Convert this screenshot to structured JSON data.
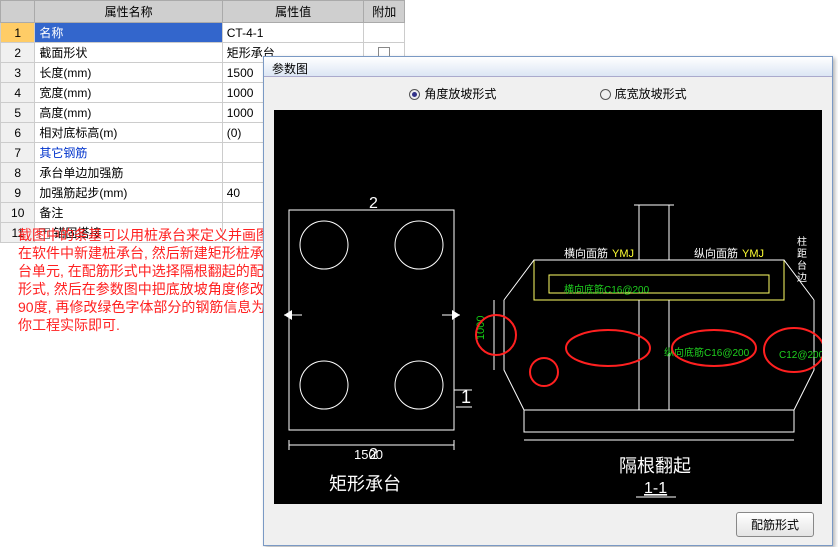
{
  "headers": {
    "name": "属性名称",
    "value": "属性值",
    "aux": "附加"
  },
  "rows": [
    {
      "n": "1",
      "name": "名称",
      "val": "CT-4-1",
      "sel": true
    },
    {
      "n": "2",
      "name": "截面形状",
      "val": "矩形承台",
      "chk": true
    },
    {
      "n": "3",
      "name": "长度(mm)",
      "val": "1500"
    },
    {
      "n": "4",
      "name": "宽度(mm)",
      "val": "1000"
    },
    {
      "n": "5",
      "name": "高度(mm)",
      "val": "1000"
    },
    {
      "n": "6",
      "name": "相对底标高(m)",
      "val": "(0)"
    },
    {
      "n": "7",
      "name": "其它钢筋",
      "val": "",
      "blue": true
    },
    {
      "n": "8",
      "name": "承台单边加强筋",
      "val": ""
    },
    {
      "n": "9",
      "name": "加强筋起步(mm)",
      "val": "40"
    },
    {
      "n": "10",
      "name": "备注",
      "val": ""
    },
    {
      "n": "11",
      "name": "锚固搭接",
      "val": "",
      "expand": true
    }
  ],
  "annotation": {
    "l1": "截图中的条基可以用桩承台来定义并画图,",
    "l2": "在软件中新建桩承台, 然后新建矩形桩承",
    "l3": "台单元, 在配筋形式中选择隔根翻起的配筋",
    "l4": "形式, 然后在参数图中把底放坡角度修改为",
    "l5": "90度, 再修改绿色字体部分的钢筋信息为",
    "l6": "你工程实际即可."
  },
  "dialog": {
    "title": "参数图",
    "opt1": "角度放坡形式",
    "opt2": "底宽放坡形式",
    "btn": "配筋形式"
  },
  "cad": {
    "dim1500": "1500",
    "one": "1",
    "two_a": "2",
    "two_b": "2",
    "shape_label": "矩形承台",
    "section_label": "隔根翻起",
    "section_sub": "1-1",
    "txt_hx_left": "横向面筋",
    "txt_hx_left_code": "YMJ",
    "txt_zx_right": "纵向面筋",
    "txt_zx_right_code": "YMJ",
    "rebar1": "横向底筋C16@200",
    "rebar2": "纵向底筋C16@200",
    "rebar3": "C12@200",
    "dim1000": "1000"
  }
}
